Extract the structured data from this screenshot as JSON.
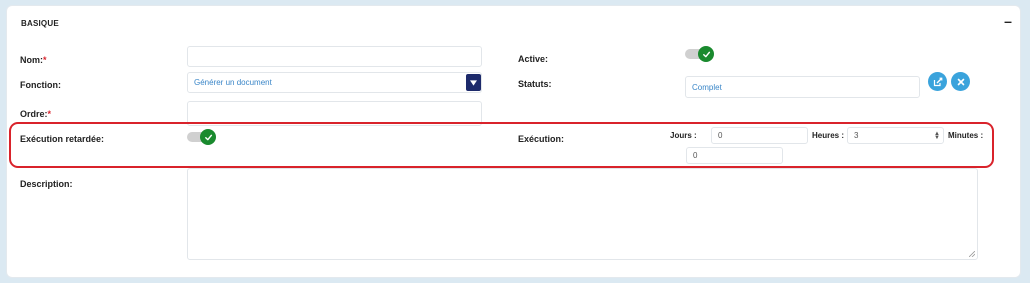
{
  "section": {
    "title": "BASIQUE",
    "collapse_symbol": "–"
  },
  "left": {
    "nom_label": "Nom:",
    "nom_value": "",
    "fonction_label": "Fonction:",
    "fonction_value": "Générer un document",
    "ordre_label": "Ordre:",
    "ordre_value": "",
    "execution_retardee_label": "Exécution retardée:",
    "execution_retardee_on": true,
    "description_label": "Description:",
    "description_value": "",
    "required_marker": "*"
  },
  "right": {
    "active_label": "Active:",
    "active_on": true,
    "statuts_label": "Statuts:",
    "statuts_value": "Complet",
    "execution_label": "Exécution:",
    "jours_label": "Jours :",
    "jours_value": "0",
    "heures_label": "Heures :",
    "heures_value": "3",
    "minutes_label": "Minutes :",
    "minutes_value": "0"
  },
  "colors": {
    "toggle_on": "#1a8a2e",
    "select_arrow": "#1d2a6b",
    "action_button": "#3aa3dc",
    "highlight": "#d9232b"
  },
  "icons": {
    "toggle_knob": "check-icon",
    "edit": "edit-icon",
    "clear": "close-icon",
    "select": "caret-down-icon"
  }
}
